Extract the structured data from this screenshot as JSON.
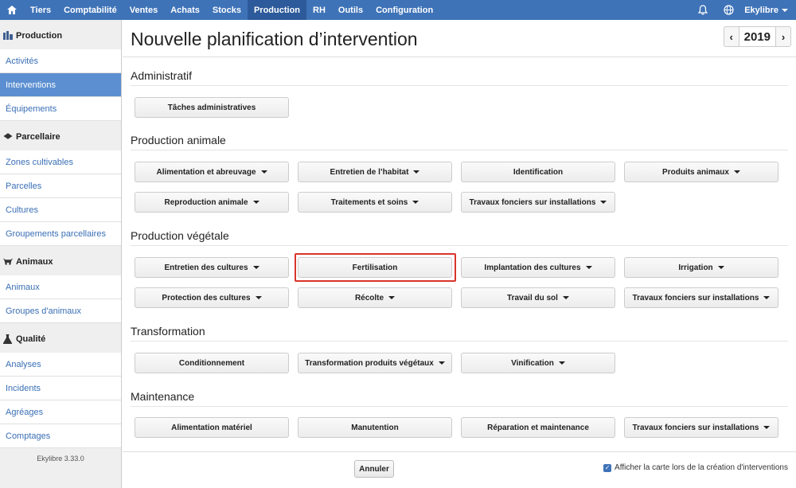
{
  "topnav": {
    "items": [
      {
        "label": "Tiers",
        "active": false
      },
      {
        "label": "Comptabilité",
        "active": false
      },
      {
        "label": "Ventes",
        "active": false
      },
      {
        "label": "Achats",
        "active": false
      },
      {
        "label": "Stocks",
        "active": false
      },
      {
        "label": "Production",
        "active": true
      },
      {
        "label": "RH",
        "active": false
      },
      {
        "label": "Outils",
        "active": false
      },
      {
        "label": "Configuration",
        "active": false
      }
    ],
    "user": "Ekylibre",
    "colors": {
      "bar": "#3f73b8",
      "active": "#2d5a9a"
    }
  },
  "sidebar": {
    "production": {
      "heading": "Production",
      "items": [
        "Activités",
        "Interventions",
        "Équipements"
      ],
      "active_index": 1
    },
    "parcellaire": {
      "heading": "Parcellaire",
      "items": [
        "Zones cultivables",
        "Parcelles",
        "Cultures",
        "Groupements parcellaires"
      ]
    },
    "animaux": {
      "heading": "Animaux",
      "items": [
        "Animaux",
        "Groupes d'animaux"
      ]
    },
    "qualite": {
      "heading": "Qualité",
      "items": [
        "Analyses",
        "Incidents",
        "Agréages",
        "Comptages"
      ]
    },
    "version": "Ekylibre 3.33.0"
  },
  "main": {
    "title": "Nouvelle planification d’intervention",
    "year": "2019",
    "sections": {
      "administratif": {
        "title": "Administratif",
        "buttons": [
          {
            "label": "Tâches administratives",
            "dropdown": false
          }
        ]
      },
      "production_animale": {
        "title": "Production animale",
        "buttons": [
          {
            "label": "Alimentation et abreuvage",
            "dropdown": true
          },
          {
            "label": "Entretien de l’habitat",
            "dropdown": true
          },
          {
            "label": "Identification",
            "dropdown": false
          },
          {
            "label": "Produits animaux",
            "dropdown": true
          },
          {
            "label": "Reproduction animale",
            "dropdown": true
          },
          {
            "label": "Traitements et soins",
            "dropdown": true
          },
          {
            "label": "Travaux fonciers sur installations",
            "dropdown": true
          }
        ]
      },
      "production_vegetale": {
        "title": "Production végétale",
        "buttons": [
          {
            "label": "Entretien des cultures",
            "dropdown": true
          },
          {
            "label": "Fertilisation",
            "dropdown": false
          },
          {
            "label": "Implantation des cultures",
            "dropdown": true
          },
          {
            "label": "Irrigation",
            "dropdown": true
          },
          {
            "label": "Protection des cultures",
            "dropdown": true
          },
          {
            "label": "Récolte",
            "dropdown": true
          },
          {
            "label": "Travail du sol",
            "dropdown": true
          },
          {
            "label": "Travaux fonciers sur installations",
            "dropdown": true
          }
        ]
      },
      "transformation": {
        "title": "Transformation",
        "buttons": [
          {
            "label": "Conditionnement",
            "dropdown": false
          },
          {
            "label": "Transformation produits végétaux",
            "dropdown": true
          },
          {
            "label": "Vinification",
            "dropdown": true
          }
        ]
      },
      "maintenance": {
        "title": "Maintenance",
        "buttons": [
          {
            "label": "Alimentation matériel",
            "dropdown": false
          },
          {
            "label": "Manutention",
            "dropdown": false
          },
          {
            "label": "Réparation et maintenance",
            "dropdown": false
          },
          {
            "label": "Travaux fonciers sur installations",
            "dropdown": true
          }
        ]
      }
    },
    "highlight_color": "#d9342b"
  },
  "footer": {
    "cancel_label": "Annuler",
    "map_option_label": "Afficher la carte lors de la création d'interventions",
    "map_option_checked": true
  }
}
